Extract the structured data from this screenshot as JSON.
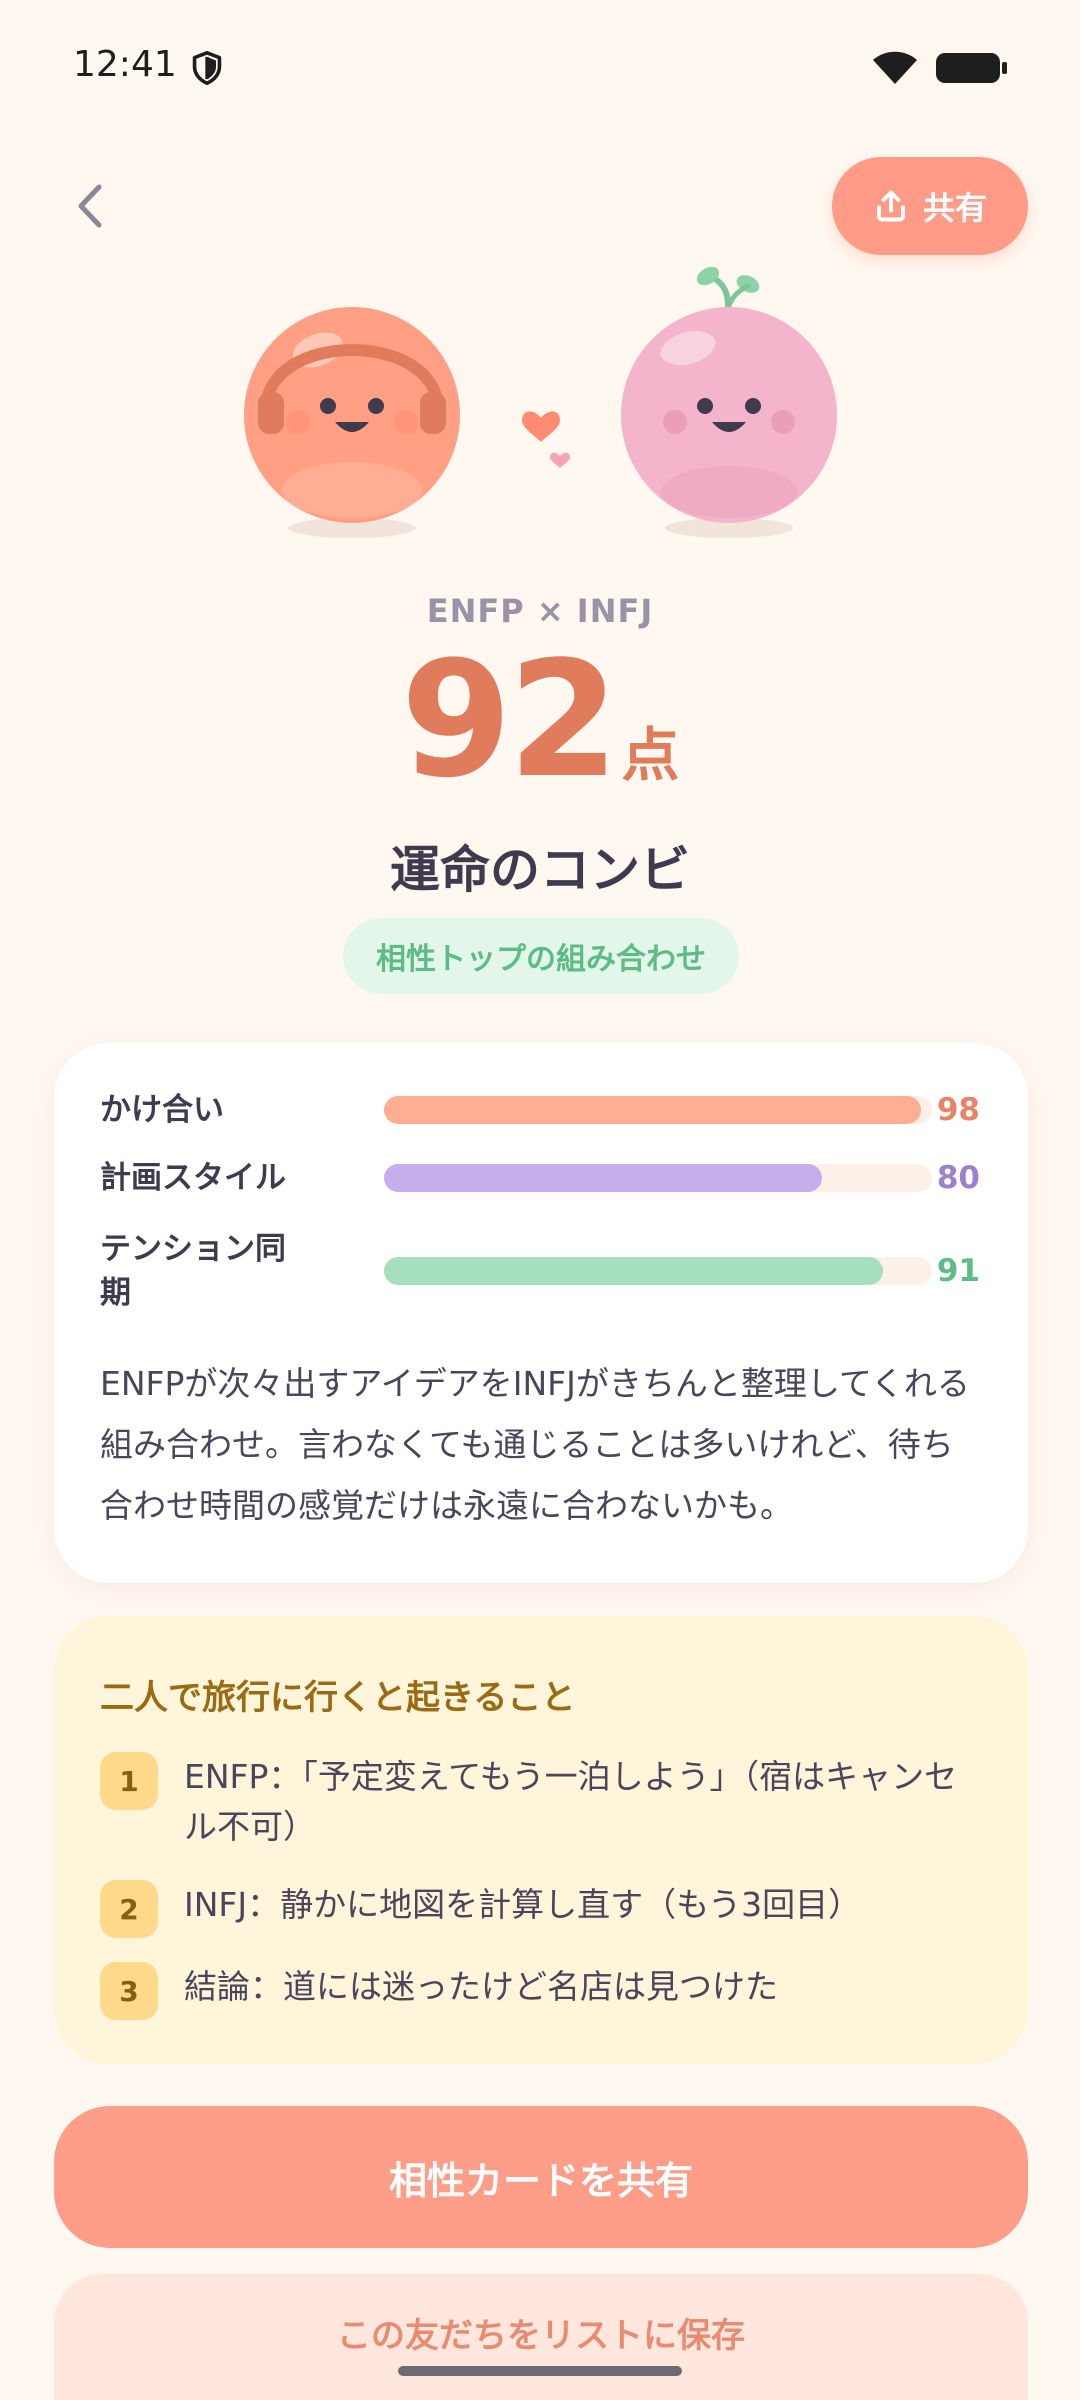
{
  "status_bar": {
    "time": "12:41"
  },
  "header": {
    "share_label": "共有"
  },
  "result": {
    "matchup": "ENFP × INFJ",
    "score": "92",
    "score_unit": "点",
    "title": "運命のコンビ",
    "badge": "相性トップの組み合わせ"
  },
  "metrics": [
    {
      "label": "かけ合い",
      "value": "98",
      "fraction": 0.98,
      "color": "#FFAE93",
      "text_color": "#E98267"
    },
    {
      "label": "計画スタイル",
      "value": "80",
      "fraction": 0.8,
      "color": "#C6AEEC",
      "text_color": "#9C82CC"
    },
    {
      "label": "テンション同期",
      "value": "91",
      "fraction": 0.91,
      "color": "#A5DFBE",
      "text_color": "#5DBB86"
    }
  ],
  "description": "ENFPが次々出すアイデアをINFJがきちんと整理してくれる組み合わせ。言わなくても通じることは多いけれど、待ち合わせ時間の感覚だけは永遠に合わないかも。",
  "trip": {
    "title": "二人で旅行に行くと起きること",
    "items": [
      {
        "num": "1",
        "text": "ENFP：「予定変えてもう一泊しよう」（宿はキャンセル不可）"
      },
      {
        "num": "2",
        "text": "INFJ：静かに地図を計算し直す（もう3回目）"
      },
      {
        "num": "3",
        "text": "結論：道には迷ったけど名店は見つけた"
      }
    ]
  },
  "buttons": {
    "share_card": "相性カードを共有",
    "save_friend": "この友だちをリストに保存"
  },
  "colors": {
    "background": "#FFF8F1",
    "accent": "#FF9E88",
    "score": "#E07B5C"
  },
  "icons": {
    "back": "chevron-left-icon",
    "share": "share-upload-icon",
    "status_shield": "shield-icon",
    "wifi": "wifi-icon",
    "battery": "battery-icon"
  }
}
